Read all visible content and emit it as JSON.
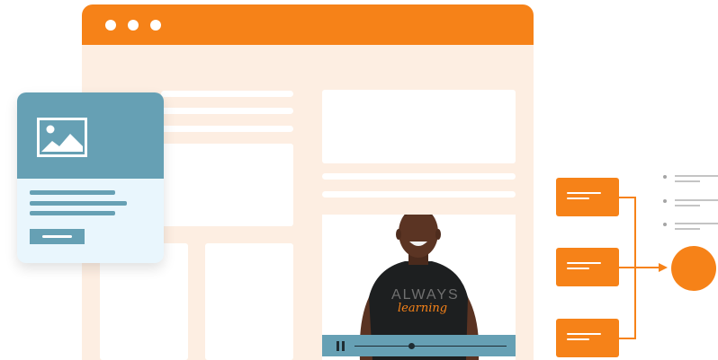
{
  "window": {
    "title_dots": 3
  },
  "video": {
    "shirt_text_line1": "ALWAYS",
    "shirt_text_line2": "learning",
    "progress": 0.35
  },
  "colors": {
    "accent": "#f68218",
    "card_blue": "#66a0b4",
    "window_bg": "#fdeee2",
    "card_bg": "#e9f6fd"
  },
  "icons": [
    "image-icon",
    "pause-icon"
  ]
}
